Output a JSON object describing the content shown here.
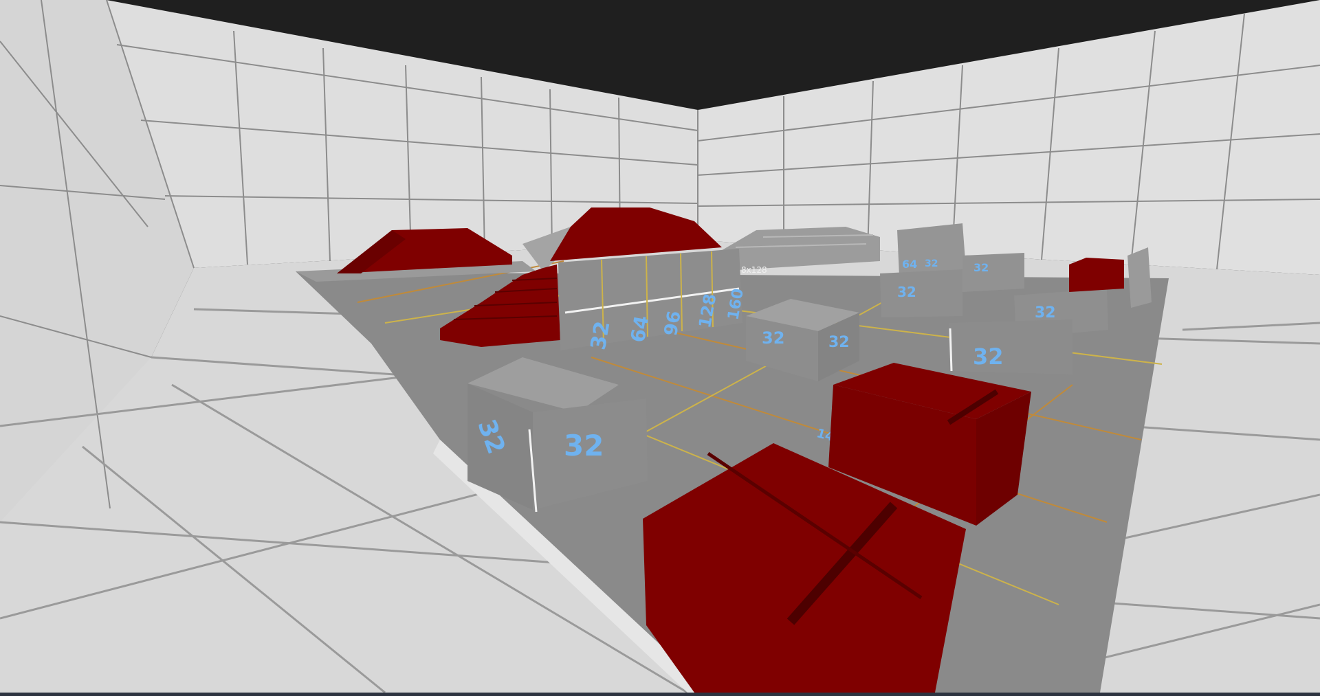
{
  "scene": {
    "type": "3D game viewport (first-person view of test map)",
    "colors": {
      "ceiling": "#1f1f1f",
      "wall": "#dcdcdc",
      "wall_grid": "#8c8c8c",
      "floor": "#d9d9d9",
      "platform": "#8a8a8a",
      "obstacle_red": "#7f0000",
      "measure_label": "#6fb2ef",
      "guide_line_orange": "#c08a3a",
      "guide_line_yellow": "#cdb34a"
    },
    "labels": {
      "wall_32": "32",
      "wall_64": "64",
      "wall_96": "96",
      "wall_128": "128",
      "wall_160": "160",
      "size_tag": "8x128",
      "block_a_left": "32",
      "block_a_front": "32",
      "block_b_left": "32",
      "block_b_right": "32",
      "block_c": "32",
      "block_d": "32",
      "block_e": "32",
      "block_f": "32",
      "floor_tag": "14",
      "tower_64": "64",
      "tower_32": "32"
    }
  }
}
